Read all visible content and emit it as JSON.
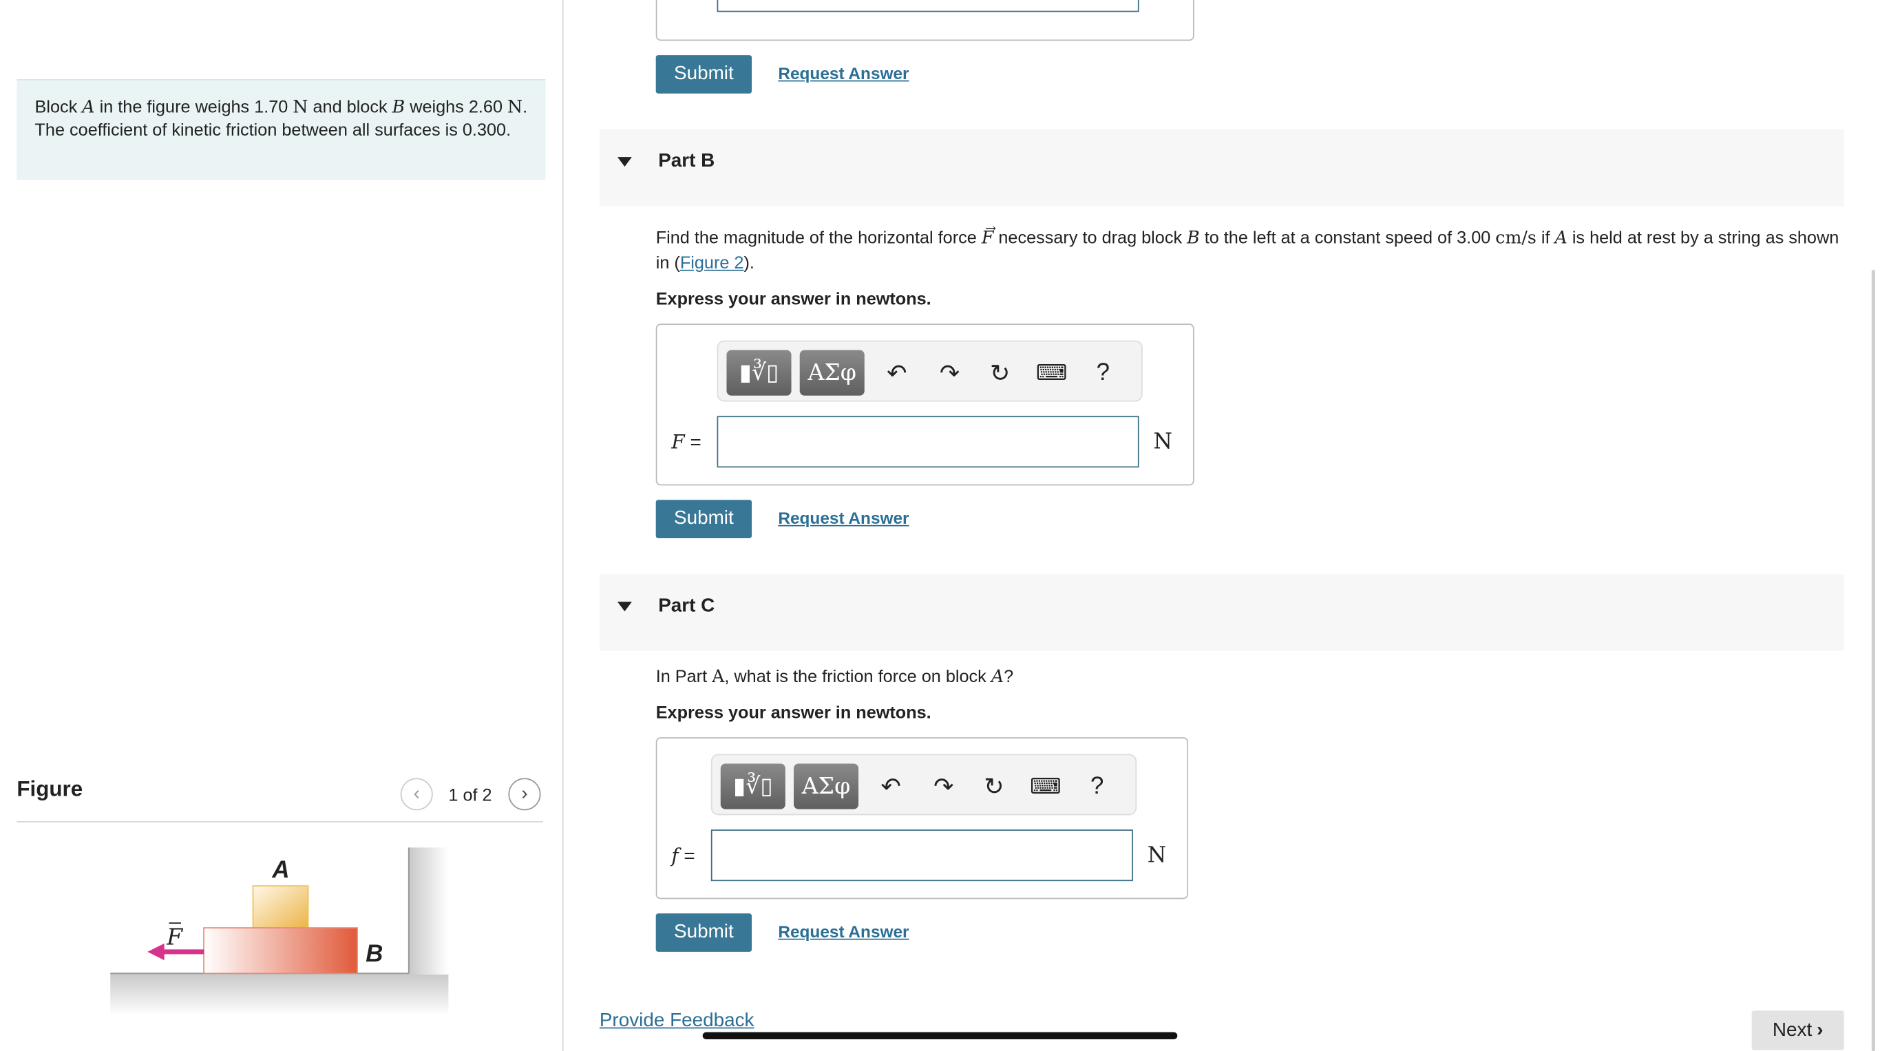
{
  "problem": {
    "t1": "Block ",
    "a": "A",
    "t2": " in the figure weighs 1.70 ",
    "n1": "N",
    "t3": " and block ",
    "b": "B",
    "t4": " weighs 2.60 ",
    "n2": "N",
    "t5": ". The coefficient of kinetic friction between all surfaces is 0.300."
  },
  "figure": {
    "title": "Figure",
    "pager": "1 of 2",
    "label_a": "A",
    "label_b": "B",
    "label_f": "F",
    "colors": {
      "block_a": "#f0c060",
      "block_b": "#e05a3a",
      "arrow": "#d6338a"
    }
  },
  "partA_tail": {
    "submit": "Submit",
    "request": "Request Answer"
  },
  "partB": {
    "label": "Part B",
    "q1": "Find the magnitude of the horizontal force ",
    "qF": "F",
    "q2": " necessary to drag block ",
    "qB": "B",
    "q3": " to the left at a constant speed of 3.00 ",
    "qunit": "cm/s",
    "q4": " if ",
    "qA": "A",
    "q5": " is held at rest by a string as shown in (",
    "qlink": "Figure 2",
    "q6": ").",
    "express": "Express your answer in newtons.",
    "var": "F",
    "eq": " =",
    "unit": "N",
    "input_value": "",
    "submit": "Submit",
    "request": "Request Answer"
  },
  "partC": {
    "label": "Part C",
    "q1": "In Part ",
    "qA1": "A",
    "q2": ", what is the friction force on block ",
    "qA2": "A",
    "q3": "?",
    "express": "Express your answer in newtons.",
    "var": "f",
    "eq": " =",
    "unit": "N",
    "input_value": "",
    "submit": "Submit",
    "request": "Request Answer"
  },
  "toolbar": {
    "templates": "▮∛▯",
    "greek": "ΑΣφ",
    "undo": "undo-icon",
    "redo": "redo-icon",
    "reset": "reset-icon",
    "keyboard": "keyboard-icon",
    "help": "?"
  },
  "footer": {
    "feedback": "Provide Feedback",
    "next": "Next"
  },
  "accent": "#387796"
}
